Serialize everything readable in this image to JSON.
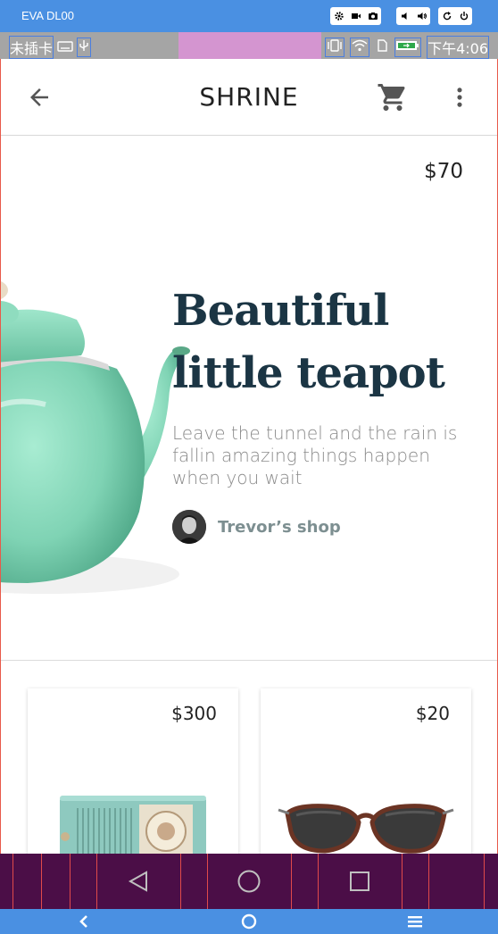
{
  "emulator": {
    "device_name": "EVA DL00",
    "toolbar_icons": [
      "settings-icon",
      "video-icon",
      "camera-icon",
      "volume-down-icon",
      "volume-up-icon",
      "rotate-icon",
      "power-icon"
    ],
    "bottom_buttons": [
      "back-chevron-icon",
      "home-circle-icon",
      "menu-icon"
    ]
  },
  "status_bar": {
    "carrier": "未插卡",
    "right_time": "下午4:06",
    "icons": [
      "keyboard-icon",
      "usb-icon",
      "vibrate-icon",
      "wifi-icon",
      "sim-icon",
      "battery-icon"
    ]
  },
  "app_bar": {
    "title": "SHRINE",
    "back_icon": "arrow-back-icon",
    "cart_icon": "shopping-cart-icon",
    "more_icon": "more-vert-icon"
  },
  "featured": {
    "price": "$70",
    "title_line1": "Beautiful",
    "title_line2": "little teapot",
    "description": "Leave the tunnel and the rain is fallin amazing things happen when you wait",
    "shop_name": "Trevor’s shop"
  },
  "products": [
    {
      "price": "$300",
      "image": "radio"
    },
    {
      "price": "$20",
      "image": "sunglasses"
    }
  ],
  "nav_bar": {
    "buttons": [
      "back-triangle-icon",
      "home-circle-icon",
      "recents-square-icon"
    ]
  },
  "colors": {
    "emulator_blue": "#4a90e2",
    "status_gray": "#a5a5a5",
    "title_navy": "#1b3544",
    "teapot_green": "#7fd3b4",
    "nav_purple": "#4b0e47"
  }
}
